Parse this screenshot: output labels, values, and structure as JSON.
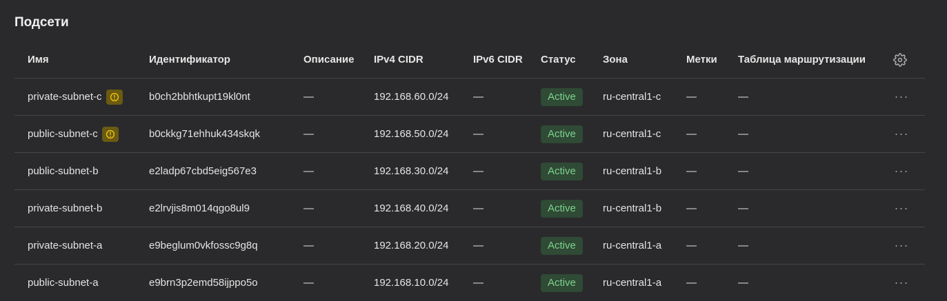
{
  "title": "Подсети",
  "columns": {
    "name": "Имя",
    "id": "Идентификатор",
    "description": "Описание",
    "ipv4": "IPv4 CIDR",
    "ipv6": "IPv6 CIDR",
    "status": "Статус",
    "zone": "Зона",
    "labels": "Метки",
    "route_table": "Таблица маршрутизации"
  },
  "icons": {
    "settings": "gear-icon",
    "warning": "warning-icon",
    "actions": "more-horizontal-icon"
  },
  "colors": {
    "status_bg": "#2f4a35",
    "status_text": "#7fd28e",
    "warning_bg": "#6a5a12",
    "warning_icon": "#f1c40f"
  },
  "rows": [
    {
      "name": "private-subnet-c",
      "warning": true,
      "id": "b0ch2bbhtkupt19kl0nt",
      "description": "—",
      "ipv4": "192.168.60.0/24",
      "ipv6": "—",
      "status": "Active",
      "zone": "ru-central1-c",
      "labels": "—",
      "route_table": "—",
      "actions": "···"
    },
    {
      "name": "public-subnet-c",
      "warning": true,
      "id": "b0ckkg71ehhuk434skqk",
      "description": "—",
      "ipv4": "192.168.50.0/24",
      "ipv6": "—",
      "status": "Active",
      "zone": "ru-central1-c",
      "labels": "—",
      "route_table": "—",
      "actions": "···"
    },
    {
      "name": "public-subnet-b",
      "warning": false,
      "id": "e2ladp67cbd5eig567e3",
      "description": "—",
      "ipv4": "192.168.30.0/24",
      "ipv6": "—",
      "status": "Active",
      "zone": "ru-central1-b",
      "labels": "—",
      "route_table": "—",
      "actions": "···"
    },
    {
      "name": "private-subnet-b",
      "warning": false,
      "id": "e2lrvjis8m014qgo8ul9",
      "description": "—",
      "ipv4": "192.168.40.0/24",
      "ipv6": "—",
      "status": "Active",
      "zone": "ru-central1-b",
      "labels": "—",
      "route_table": "—",
      "actions": "···"
    },
    {
      "name": "private-subnet-a",
      "warning": false,
      "id": "e9beglum0vkfossc9g8q",
      "description": "—",
      "ipv4": "192.168.20.0/24",
      "ipv6": "—",
      "status": "Active",
      "zone": "ru-central1-a",
      "labels": "—",
      "route_table": "—",
      "actions": "···"
    },
    {
      "name": "public-subnet-a",
      "warning": false,
      "id": "e9brn3p2emd58ijppo5o",
      "description": "—",
      "ipv4": "192.168.10.0/24",
      "ipv6": "—",
      "status": "Active",
      "zone": "ru-central1-a",
      "labels": "—",
      "route_table": "—",
      "actions": "···"
    }
  ]
}
